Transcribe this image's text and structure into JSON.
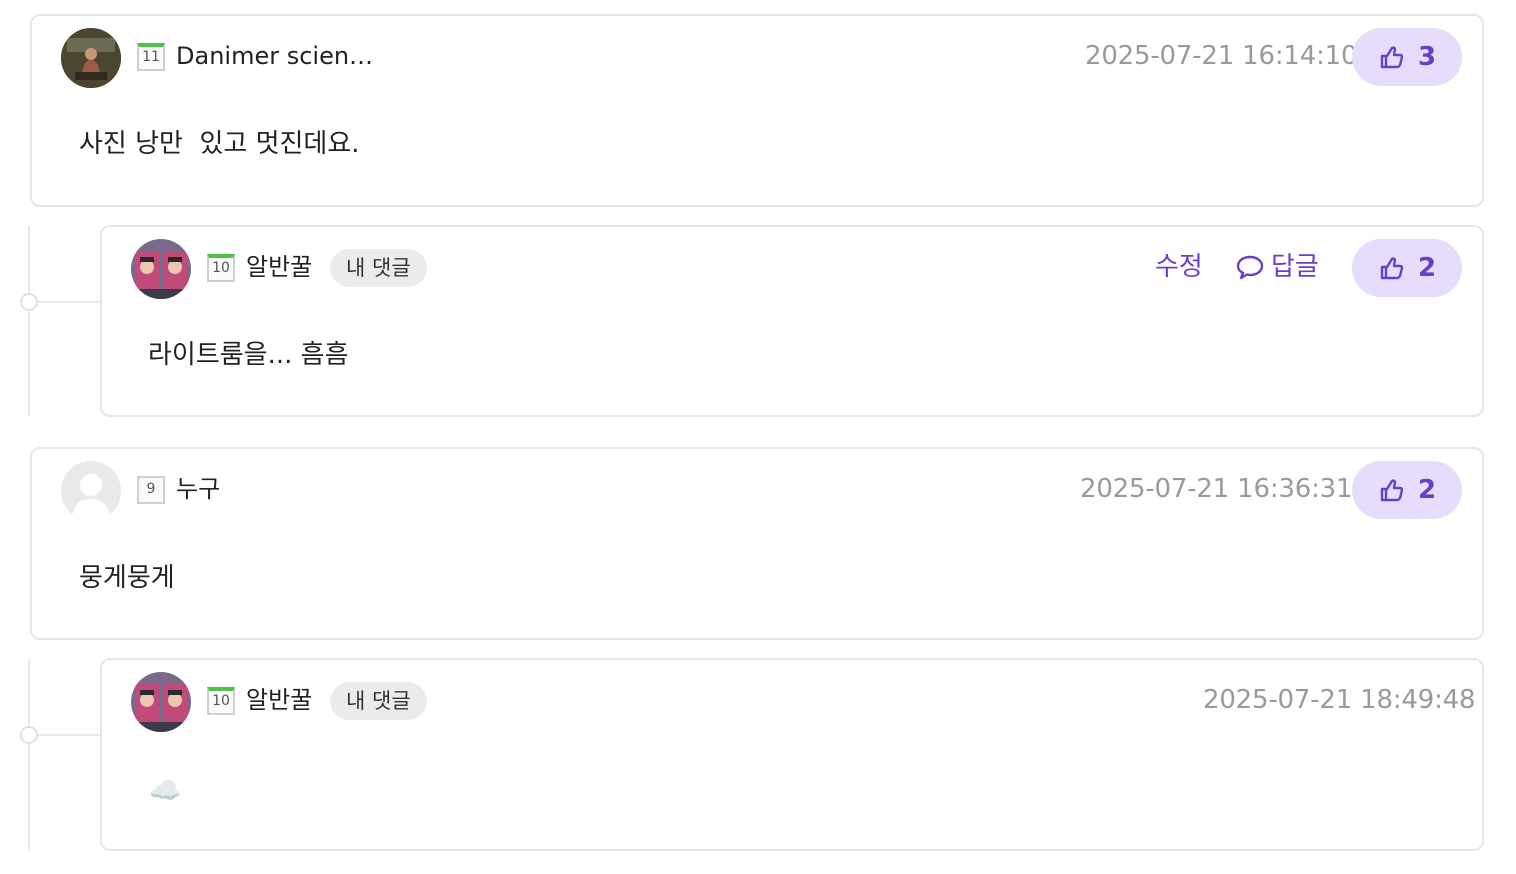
{
  "comments": [
    {
      "nickname": "Danimer scien…",
      "level": "11",
      "timestamp": "2025-07-21 16:14:10",
      "likes": "3",
      "body": "사진 낭만  있고 멋진데요.",
      "avatar": "photo-avatar"
    },
    {
      "nickname": "알반꿀",
      "level": "10",
      "badge": "내 댓글",
      "edit_label": "수정",
      "reply_label": "답글",
      "likes": "2",
      "body": "라이트룸을... 흠흠",
      "avatar": "photo-avatar"
    },
    {
      "nickname": "누구",
      "level": "9",
      "timestamp": "2025-07-21 16:36:31",
      "likes": "2",
      "body": "뭉게뭉게",
      "avatar": "default-user-icon"
    },
    {
      "nickname": "알반꿀",
      "level": "10",
      "badge": "내 댓글",
      "timestamp": "2025-07-21 18:49:48",
      "body": "☁️",
      "avatar": "photo-avatar"
    }
  ],
  "icons": {
    "like": "thumbs-up-icon",
    "reply": "speech-bubble-icon",
    "content_emoji": "cloud-emoji"
  },
  "colors": {
    "accent": "#6a3fd0",
    "like_bg": "#e6dcfb",
    "level_stripe": "#4fc24a",
    "timestamp": "#9a9a9a"
  }
}
